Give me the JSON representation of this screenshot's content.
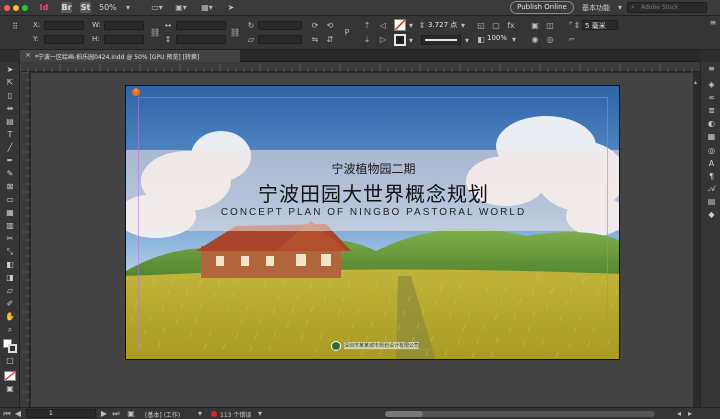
{
  "app": {
    "icon_label": "Id",
    "bridge_label": "Br",
    "stock_label": "St",
    "zoom": "50%",
    "publish_label": "Publish Online",
    "workspace_label": "基本功能",
    "search_placeholder": "Adobe Stock"
  },
  "control": {
    "x_label": "X:",
    "y_label": "Y:",
    "w_label": "W:",
    "h_label": "H:",
    "stroke_weight": "3.727 点",
    "opacity": "100%",
    "corner_size": "5 毫米"
  },
  "document": {
    "tab_title": "*宁波一区绘画-拍乐园0424.indd @ 50% [GPU 预览] [转换]"
  },
  "page": {
    "subtitle": "宁波植物园二期",
    "title": "宁波田园大世界概念规划",
    "english_title": "CONCEPT PLAN OF NINGBO PASTORAL WORLD",
    "logo_text": "深圳市某某城市规划设计有限公司"
  },
  "status": {
    "page_number": "1",
    "style": "[基本] (工作)",
    "errors": "113 个错误"
  },
  "colors": {
    "ui_dark": "#2d2d2d",
    "pasteboard": "#434343",
    "error_red": "#e02020"
  }
}
